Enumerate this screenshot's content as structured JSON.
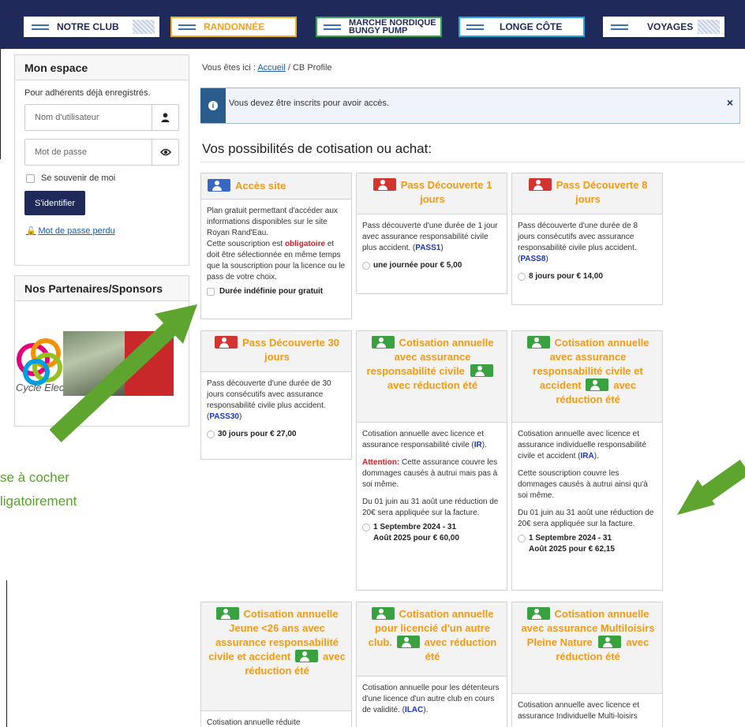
{
  "nav": [
    {
      "label": "NOTRE CLUB",
      "color": "#ffffff"
    },
    {
      "label": "RANDONNÉE",
      "color": "#f3b21b"
    },
    {
      "label": "MARCHE NORDIQUE\nBUNGY PUMP",
      "color": "#2fa64a"
    },
    {
      "label": "LONGE CÔTE",
      "color": "#1ea7e0"
    },
    {
      "label": "VOYAGES",
      "color": "#ffffff"
    }
  ],
  "sidebar": {
    "login_title": "Mon espace",
    "intro": "Pour adhérents déjà enregistrés.",
    "username_placeholder": "Nom d'utilisateur",
    "password_placeholder": "Mot de passe",
    "remember": "Se souvenir de moi",
    "login_button": "S'identifier",
    "lost_password": "Mot de passe perdu",
    "sponsors_title": "Nos Partenaires/Sponsors",
    "sponsor_name": "Cycle Elec"
  },
  "overlay": {
    "line1": "se à cocher",
    "line2": "ligatoirement",
    "arrow_color": "#5ea52f"
  },
  "main": {
    "breadcrumb_prefix": "Vous êtes ici :",
    "breadcrumb_home": "Accueil",
    "breadcrumb_sep": "/",
    "breadcrumb_current": "CB Profile",
    "alert": "Vous devez être inscrits pour avoir accès.",
    "alert_close": "×",
    "title": "Vos possibilités de cotisation ou achat:"
  },
  "cards": {
    "c1": {
      "title": "Accès site",
      "t1": "Plan gratuit permettant d'accéder aux informations disponibles sur le site Royan Rand'Eau.",
      "t2a": "Cette souscription est ",
      "t2b": "obligatoire",
      "t2c": " et doit être sélectionnée en  même temps que la souscription pour la licence ou le pass de votre choix.",
      "option": "Durée indéfinie pour gratuit"
    },
    "c2": {
      "title": "Pass Découverte 1 jours",
      "t1": "Pass découverte d'une durée de 1 jour avec assurance responsabilité civile plus accident. (",
      "code": "PASS1",
      "t1_end": ")",
      "option": "une journée pour € 5,00"
    },
    "c3": {
      "title": "Pass Découverte 8 jours",
      "t1": "Pass découverte d'une durée de 8 jours consécutifs avec assurance responsabilité civile plus accident. (",
      "code": "PASS8",
      "t1_end": ")",
      "option": "8 jours pour € 14,00"
    },
    "c4": {
      "title": "Pass Découverte 30 jours",
      "t1": "Pass découverte d'une durée de 30 jours consécutifs avec assurance responsabilité civile plus accident. (",
      "code": "PASS30",
      "t1_end": ")",
      "option": "30 jours pour € 27,00"
    },
    "c5": {
      "title1": "Cotisation annuelle avec assurance responsabilité civile",
      "title2": "avec réduction été",
      "t1": "Cotisation annuelle avec licence et assurance responsabilité civile (",
      "code": "IR",
      "t1_end": ").",
      "att": "Attention:",
      "t2": " Cette assurance couvre les dommages causés à autrui mais pas à soi même.",
      "t3": "Du 01 juin au 31 août une réduction de 20€ sera appliquée sur la facture.",
      "option1": "1 Septembre 2024 - 31",
      "option2": "Août 2025 pour € 60,00"
    },
    "c6": {
      "title1": "Cotisation annuelle avec assurance responsabilité civile et accident",
      "title2": "avec réduction été",
      "t1": "Cotisation annuelle avec licence et assurance individuelle responsabilité civile et accident (",
      "code": "IRA",
      "t1_end": ").",
      "t2": "Cette souscription couvre les dommages causés à autrui ainsi qu'à soi même.",
      "t3": "Du 01 juin au 31 août une réduction de 20€ sera appliquée sur la facture.",
      "option1": "1 Septembre 2024 - 31",
      "option2": "Août 2025 pour € 62,15"
    },
    "c7": {
      "title1": "Cotisation annuelle Jeune <26 ans avec assurance responsabilité civile et accident",
      "title2": "avec réduction été",
      "t1": "Cotisation annuelle réduite"
    },
    "c8": {
      "title1": "Cotisation annuelle pour licencié d'un autre club.",
      "title2": "avec réduction été",
      "t1": "Cotisation annuelle pour les détenteurs d'une licence d'un autre club en cours de validité. (",
      "code": "ILAC",
      "t1_end": ")."
    },
    "c9": {
      "title1": "Cotisation annuelle avec assurance Multiloisirs Pleine Nature",
      "title2": "avec réduction été",
      "t1": "Cotisation annuelle avec licence et assurance Individuelle Multi-loisirs"
    }
  }
}
